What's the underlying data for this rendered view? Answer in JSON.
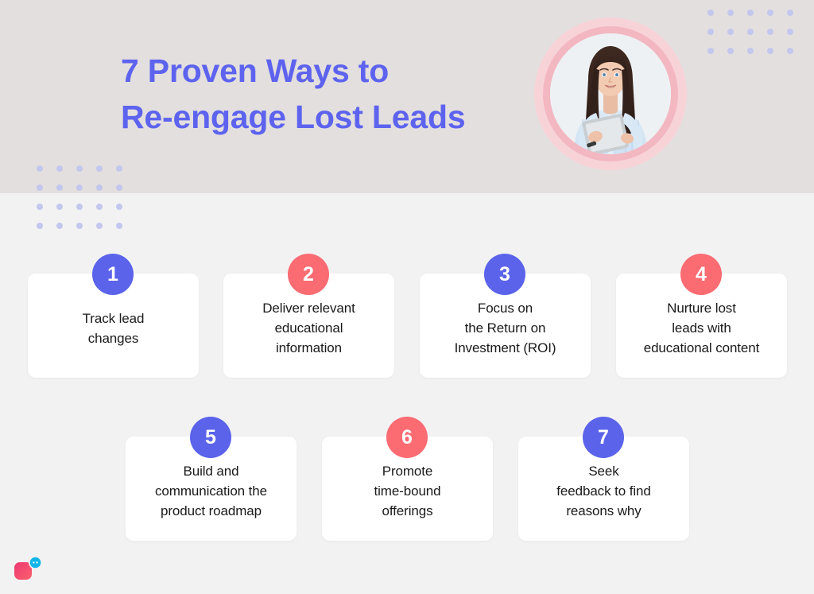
{
  "header": {
    "title_line1": "7 Proven Ways to",
    "title_line2": "Re-engage Lost Leads",
    "title_color": "#5d63ee",
    "background_color": "#e3dfde",
    "portrait_alt": "smiling-woman-holding-tablet",
    "portrait_ring_outer_color": "#f7d3d8",
    "portrait_ring_inner_color": "#f3b7c1"
  },
  "page": {
    "background_color": "#f2f2f2",
    "dot_color": "#c3c7ee"
  },
  "decor": {
    "dot_grid_top_right": {
      "columns": 5,
      "rows": 3
    },
    "dot_grid_left": {
      "columns": 5,
      "rows": 4
    }
  },
  "colors": {
    "badge_blue": "#5a63ea",
    "badge_coral": "#fa6b72",
    "card_background": "#ffffff",
    "card_text": "#1a1a1a",
    "logo_pink": "#ef3d6d",
    "logo_pink_light": "#fb5a70",
    "logo_cyan": "#12b5e8"
  },
  "cards": [
    {
      "number": "1",
      "text": "Track lead\nchanges",
      "badge_color": "#5a63ea"
    },
    {
      "number": "2",
      "text": "Deliver relevant\neducational\ninformation",
      "badge_color": "#fa6b72"
    },
    {
      "number": "3",
      "text": "Focus on\nthe Return on\nInvestment (ROI)",
      "badge_color": "#5a63ea"
    },
    {
      "number": "4",
      "text": "Nurture lost\nleads with\neducational content",
      "badge_color": "#fa6b72"
    },
    {
      "number": "5",
      "text": "Build and\ncommunication the\nproduct roadmap",
      "badge_color": "#5a63ea"
    },
    {
      "number": "6",
      "text": "Promote\ntime-bound\nofferings",
      "badge_color": "#fa6b72"
    },
    {
      "number": "7",
      "text": "Seek\nfeedback to find\nreasons why",
      "badge_color": "#5a63ea"
    }
  ],
  "logo": {
    "name": "chat-bubble-logo"
  }
}
